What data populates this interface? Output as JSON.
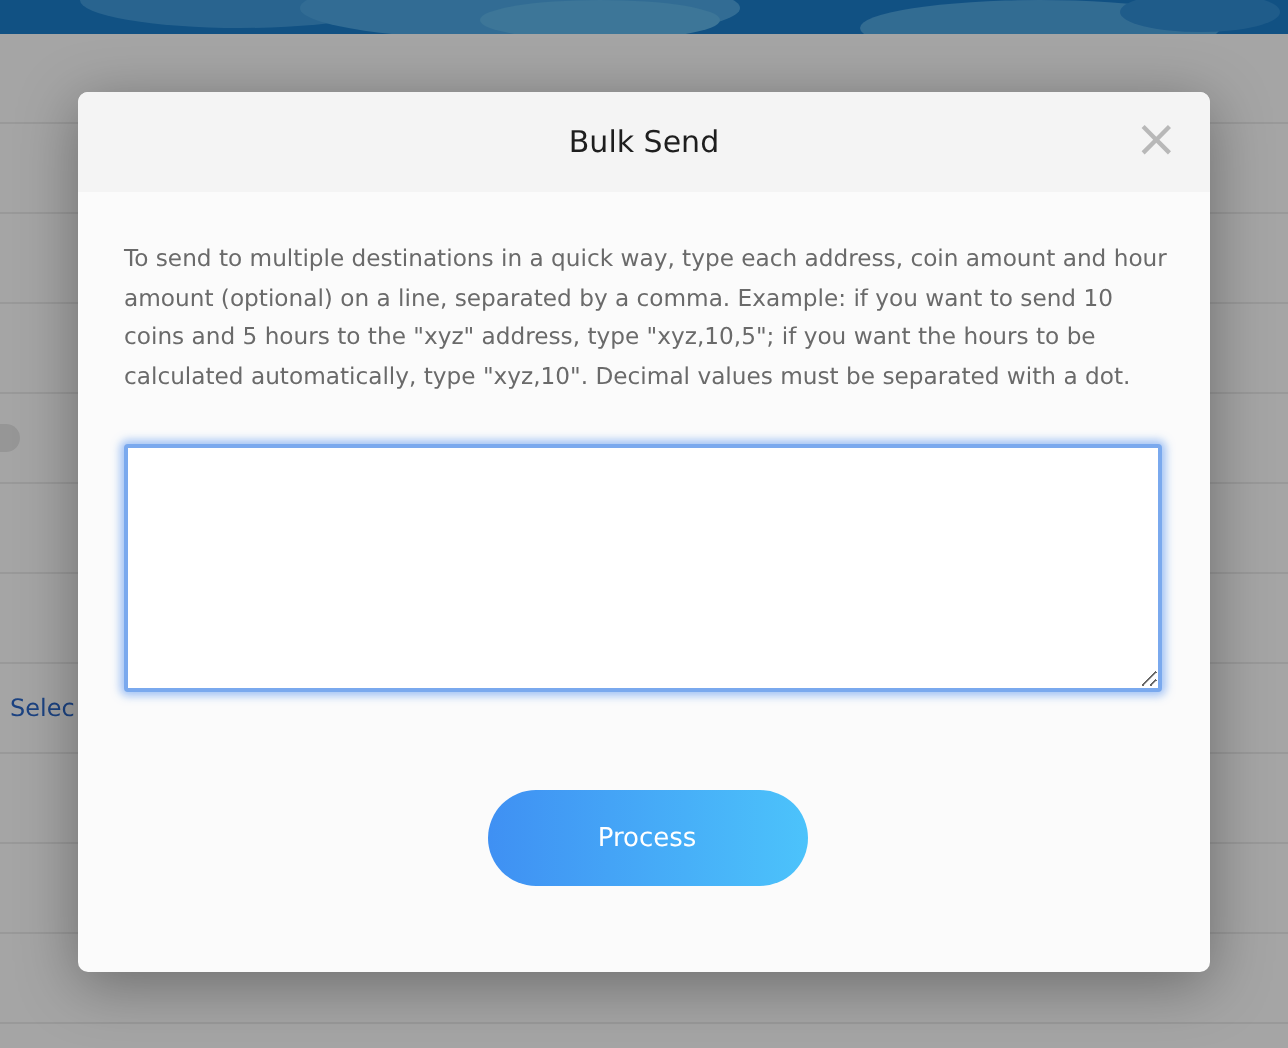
{
  "background": {
    "link": "Selec"
  },
  "dialog": {
    "title": "Bulk Send",
    "close_icon": "×",
    "instructions": "To send to multiple destinations in a quick way, type each address, coin amount and hour amount (optional) on a line, separated by a comma. Example: if you want to send 10 coins and 5 hours to the \"xyz\" address, type \"xyz,10,5\"; if you want the hours to be calculated automatically, type \"xyz,10\". Decimal values must be separated with a dot.",
    "input": {
      "focused": true
    },
    "button": "Process"
  }
}
